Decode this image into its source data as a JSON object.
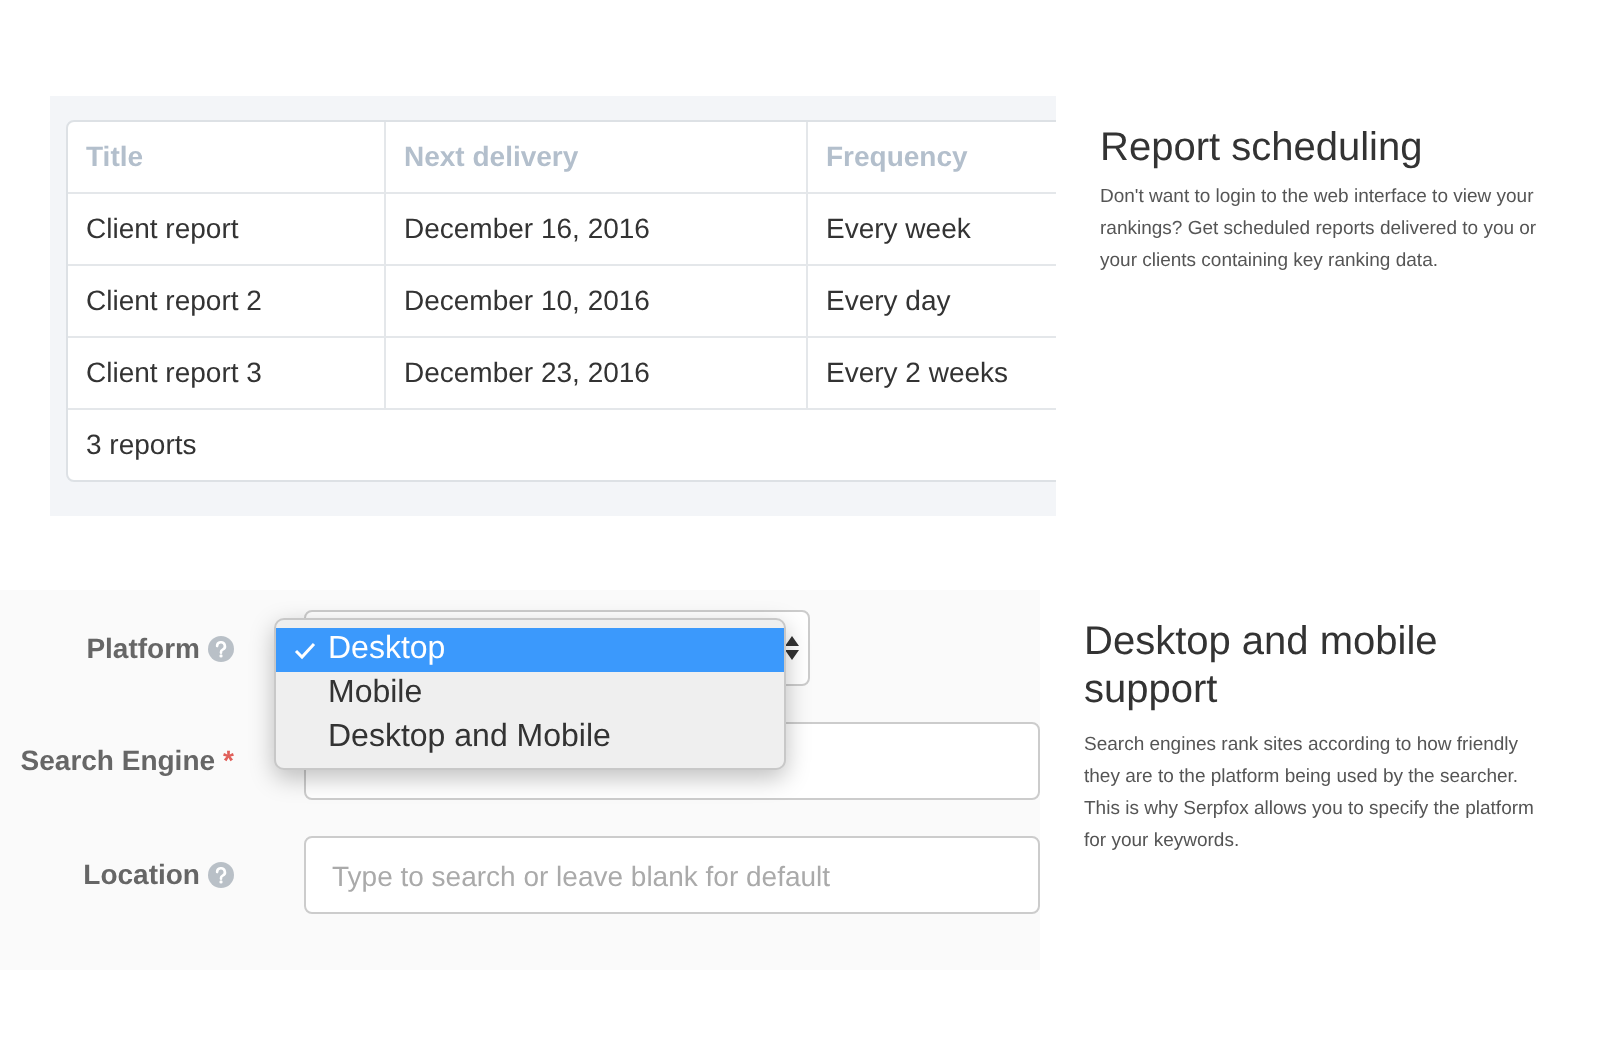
{
  "report_table": {
    "columns": [
      "Title",
      "Next delivery",
      "Frequency"
    ],
    "rows": [
      [
        "Client report",
        "December 16, 2016",
        "Every week"
      ],
      [
        "Client report 2",
        "December 10, 2016",
        "Every day"
      ],
      [
        "Client report 3",
        "December 23, 2016",
        "Every 2 weeks"
      ]
    ],
    "footer": "3 reports"
  },
  "report_section": {
    "heading": "Report scheduling",
    "text": "Don't want to login to the web interface to view your rankings? Get scheduled reports delivered to you or your clients containing key ranking data."
  },
  "form": {
    "fields": [
      {
        "kind": "select",
        "label": "Platform",
        "help": true,
        "options": [
          {
            "label": "Desktop",
            "selected": true
          },
          {
            "label": "Mobile",
            "selected": false
          },
          {
            "label": "Desktop and Mobile",
            "selected": false
          }
        ]
      },
      {
        "kind": "input",
        "label": "Search Engine",
        "required_mark": "*",
        "help": false
      },
      {
        "kind": "input",
        "label": "Location",
        "help": true,
        "placeholder": "Type to search or leave blank for default"
      }
    ]
  },
  "platform_section": {
    "heading": "Desktop and mobile support",
    "text": "Search engines rank sites according to how friendly they are to the platform being used by the searcher. This is why Serpfox allows you to specify the platform for your keywords."
  }
}
